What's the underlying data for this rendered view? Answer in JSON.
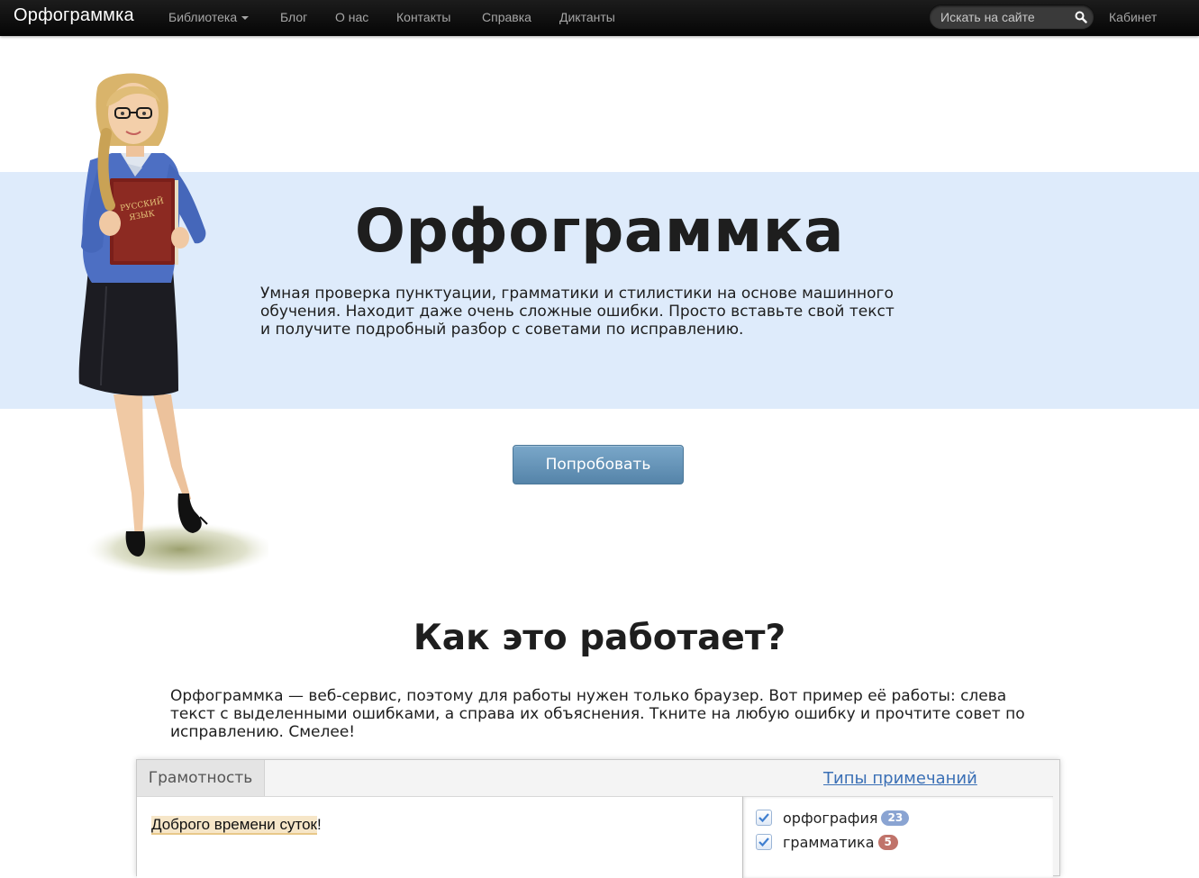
{
  "navbar": {
    "brand": "Орфограммка",
    "items": [
      {
        "label": "Библиотека",
        "dropdown": true
      },
      {
        "label": "Блог"
      },
      {
        "label": "О нас"
      },
      {
        "label": "Контакты"
      },
      {
        "label": "Справка"
      },
      {
        "label": "Диктанты"
      }
    ],
    "search_placeholder": "Искать на сайте",
    "cabinet": "Кабинет"
  },
  "hero": {
    "title": "Орфограммка",
    "text": "Умная проверка пунктуации, грамматики и стилистики на основе машинного обучения. Находит даже очень сложные ошибки. Просто вставьте свой текст и получите подробный разбор с советами по исправлению.",
    "button": "Попробовать",
    "book_lines": [
      "РУССКИЙ",
      "ЯЗЫК"
    ]
  },
  "how": {
    "title": "Как это работает?",
    "text": "Орфограммка — веб-сервис, поэтому для работы нужен только браузер. Вот пример её работы: слева текст с выделенными ошибками, а справа их объяснения. Ткните на любую ошибку и прочтите совет по исправлению. Смелее!"
  },
  "demo": {
    "tab": "Грамотность",
    "types_link": "Типы примечаний",
    "editor_marked": "Доброго времени суток",
    "editor_rest": "!",
    "notes": [
      {
        "label": "орфография",
        "count": "23",
        "color": "#8aa4d2"
      },
      {
        "label": "грамматика",
        "count": "5",
        "color": "#c0736a"
      }
    ]
  },
  "colors": {
    "hero_band": "#deebfb",
    "button": "#6592b6",
    "link": "#3a6fb5"
  }
}
